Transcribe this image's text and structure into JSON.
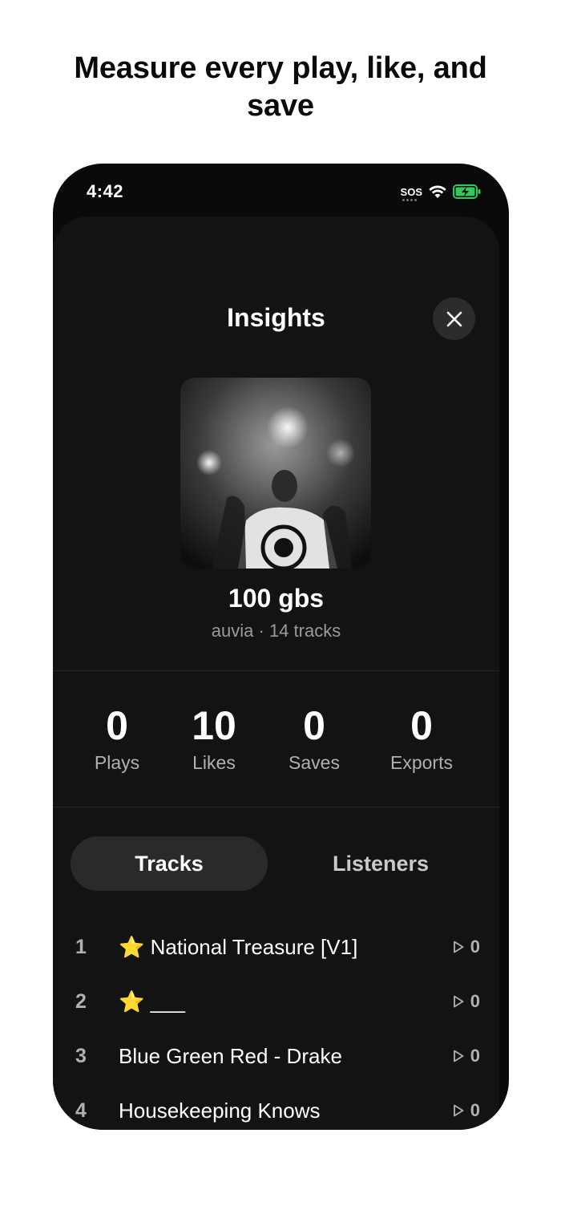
{
  "headline": {
    "line1": "Measure every play, like, and",
    "line2": "save"
  },
  "status_bar": {
    "time": "4:42",
    "carrier": "SOS",
    "icons": [
      "wifi-icon",
      "battery-charging-icon"
    ],
    "battery_color": "#34c759"
  },
  "sheet": {
    "title": "Insights",
    "close_icon": "close-icon",
    "playlist": {
      "name": "100 gbs",
      "subtitle": "auvia · 14 tracks"
    }
  },
  "stats": [
    {
      "value": "0",
      "label": "Plays"
    },
    {
      "value": "10",
      "label": "Likes"
    },
    {
      "value": "0",
      "label": "Saves"
    },
    {
      "value": "0",
      "label": "Exports"
    }
  ],
  "tabs": [
    {
      "label": "Tracks",
      "active": true
    },
    {
      "label": "Listeners",
      "active": false
    }
  ],
  "tracks": [
    {
      "index": "1",
      "title": "⭐ National Treasure [V1]",
      "plays": "0"
    },
    {
      "index": "2",
      "title": "⭐ ___",
      "plays": "0"
    },
    {
      "index": "3",
      "title": "Blue Green Red - Drake",
      "plays": "0"
    },
    {
      "index": "4",
      "title": "Housekeeping Knows",
      "plays": "0"
    }
  ]
}
